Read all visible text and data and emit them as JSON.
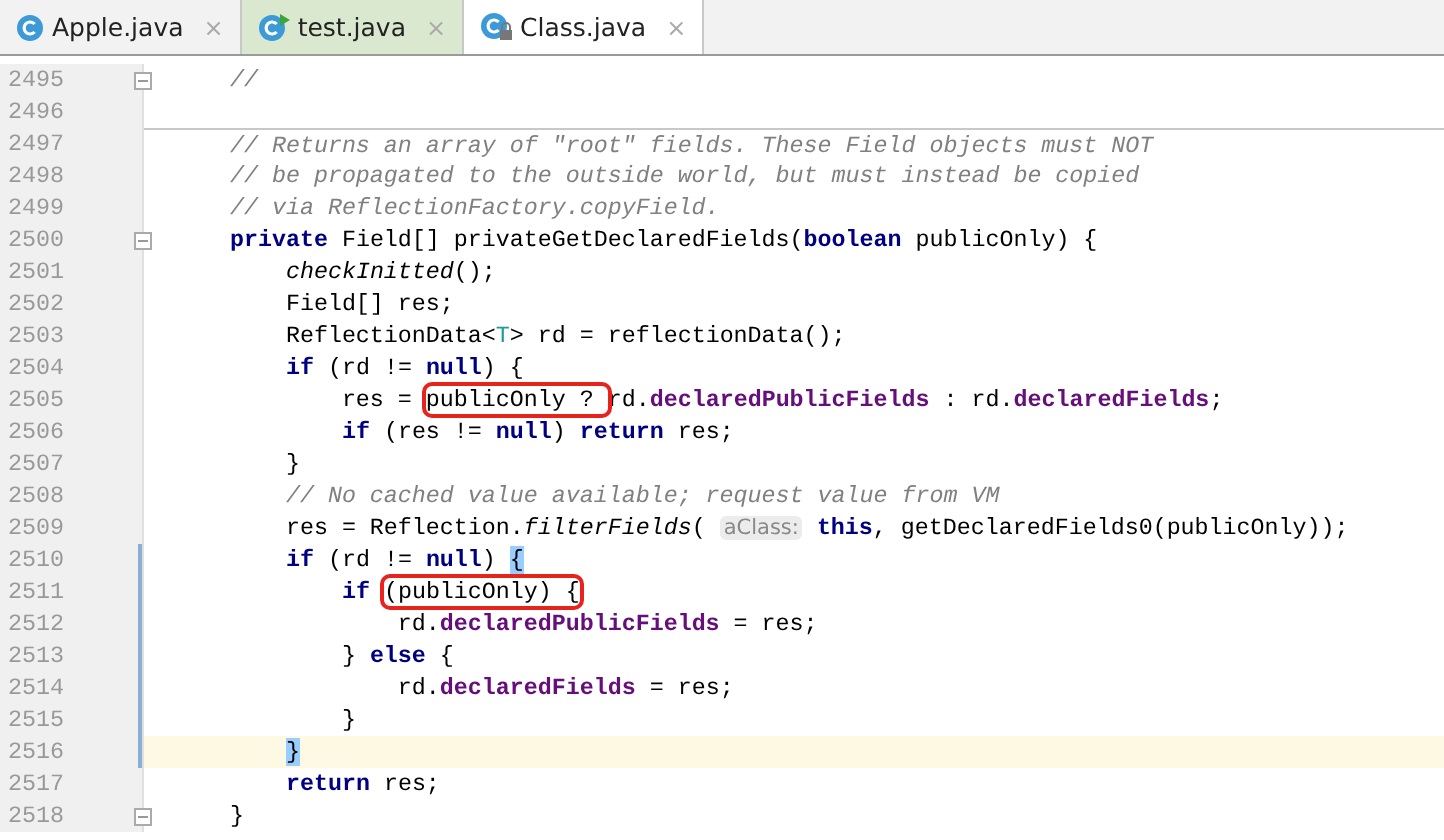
{
  "tabs": [
    {
      "label": "Apple.java",
      "close": "×",
      "selected": false,
      "kind": "class"
    },
    {
      "label": "test.java",
      "close": "×",
      "selected": false,
      "kind": "test"
    },
    {
      "label": "Class.java",
      "close": "×",
      "selected": true,
      "kind": "library"
    }
  ],
  "editor": {
    "lines": [
      {
        "number": "2495",
        "foldable": true,
        "tokens": [
          {
            "text": "    //",
            "kind": "comment"
          }
        ]
      },
      {
        "number": "2496"
      },
      {
        "number": "2497",
        "separator_above": true,
        "tokens": [
          {
            "text": "    // Returns an array of \"root\" fields. These Field objects must NOT",
            "kind": "comment"
          }
        ]
      },
      {
        "number": "2498",
        "tokens": [
          {
            "text": "    // be propagated to the outside world, but must instead be copied",
            "kind": "comment"
          }
        ]
      },
      {
        "number": "2499",
        "tokens": [
          {
            "text": "    // via ReflectionFactory.copyField.",
            "kind": "comment"
          }
        ]
      },
      {
        "number": "2500",
        "foldable": true,
        "tokens": [
          {
            "text": "    private",
            "kind": "keyword"
          },
          {
            "text": " Field[] privateGetDeclaredFields(",
            "kind": "plain"
          },
          {
            "text": "boolean",
            "kind": "keyword"
          },
          {
            "text": " publicOnly) {",
            "kind": "plain"
          }
        ]
      },
      {
        "number": "2501",
        "tokens": [
          {
            "text": "        checkInitted",
            "kind": "static"
          },
          {
            "text": "();",
            "kind": "plain"
          }
        ]
      },
      {
        "number": "2502",
        "tokens": [
          {
            "text": "        Field[] res;",
            "kind": "plain"
          }
        ]
      },
      {
        "number": "2503",
        "tokens": [
          {
            "text": "        ReflectionData<",
            "kind": "plain"
          },
          {
            "text": "T",
            "kind": "type"
          },
          {
            "text": "> rd = reflectionData();",
            "kind": "plain"
          }
        ]
      },
      {
        "number": "2504",
        "tokens": [
          {
            "text": "        if",
            "kind": "keyword"
          },
          {
            "text": " (rd != ",
            "kind": "plain"
          },
          {
            "text": "null",
            "kind": "keyword"
          },
          {
            "text": ") {",
            "kind": "plain"
          }
        ]
      },
      {
        "number": "2505",
        "tokens": [
          {
            "text": "            res = ",
            "kind": "plain"
          },
          {
            "text": "publicOnly ? ",
            "kind": "plain",
            "boxed": true
          },
          {
            "text": "rd.",
            "kind": "plain"
          },
          {
            "text": "declaredPublicFields",
            "kind": "field"
          },
          {
            "text": " : rd.",
            "kind": "plain"
          },
          {
            "text": "declaredFields",
            "kind": "field"
          },
          {
            "text": ";",
            "kind": "plain"
          }
        ]
      },
      {
        "number": "2506",
        "tokens": [
          {
            "text": "            if",
            "kind": "keyword"
          },
          {
            "text": " (res != ",
            "kind": "plain"
          },
          {
            "text": "null",
            "kind": "keyword"
          },
          {
            "text": ") ",
            "kind": "plain"
          },
          {
            "text": "return",
            "kind": "keyword"
          },
          {
            "text": " res;",
            "kind": "plain"
          }
        ]
      },
      {
        "number": "2507",
        "tokens": [
          {
            "text": "        }",
            "kind": "plain"
          }
        ]
      },
      {
        "number": "2508",
        "tokens": [
          {
            "text": "        // No cached value available; request value from VM",
            "kind": "comment"
          }
        ]
      },
      {
        "number": "2509",
        "tokens": [
          {
            "text": "        res = Reflection.",
            "kind": "plain"
          },
          {
            "text": "filterFields",
            "kind": "static"
          },
          {
            "text": "( ",
            "kind": "plain"
          },
          {
            "text": "aClass:",
            "kind": "hint"
          },
          {
            "text": " this",
            "kind": "keyword"
          },
          {
            "text": ", getDeclaredFields0(publicOnly));",
            "kind": "plain"
          }
        ]
      },
      {
        "number": "2510",
        "changed": true,
        "tokens": [
          {
            "text": "        if",
            "kind": "keyword"
          },
          {
            "text": " (rd != ",
            "kind": "plain"
          },
          {
            "text": "null",
            "kind": "keyword"
          },
          {
            "text": ") ",
            "kind": "plain"
          },
          {
            "text": "{",
            "kind": "brace"
          }
        ]
      },
      {
        "number": "2511",
        "changed": true,
        "tokens": [
          {
            "text": "            if",
            "kind": "keyword"
          },
          {
            "text": " (publicOnly) {",
            "kind": "plain",
            "boxed": true
          }
        ]
      },
      {
        "number": "2512",
        "changed": true,
        "tokens": [
          {
            "text": "                rd.",
            "kind": "plain"
          },
          {
            "text": "declaredPublicFields",
            "kind": "field"
          },
          {
            "text": " = res;",
            "kind": "plain"
          }
        ]
      },
      {
        "number": "2513",
        "changed": true,
        "tokens": [
          {
            "text": "            } ",
            "kind": "plain"
          },
          {
            "text": "else",
            "kind": "keyword"
          },
          {
            "text": " {",
            "kind": "plain"
          }
        ]
      },
      {
        "number": "2514",
        "changed": true,
        "tokens": [
          {
            "text": "                rd.",
            "kind": "plain"
          },
          {
            "text": "declaredFields",
            "kind": "field"
          },
          {
            "text": " = res;",
            "kind": "plain"
          }
        ]
      },
      {
        "number": "2515",
        "changed": true,
        "tokens": [
          {
            "text": "            }",
            "kind": "plain"
          }
        ]
      },
      {
        "number": "2516",
        "changed": true,
        "current": true,
        "tokens": [
          {
            "text": "        }",
            "kind": "brace"
          }
        ]
      },
      {
        "number": "2517",
        "tokens": [
          {
            "text": "        return",
            "kind": "keyword"
          },
          {
            "text": " res;",
            "kind": "plain"
          }
        ]
      },
      {
        "number": "2518",
        "foldable": true,
        "tokens": [
          {
            "text": "    }",
            "kind": "plain"
          }
        ]
      }
    ]
  }
}
